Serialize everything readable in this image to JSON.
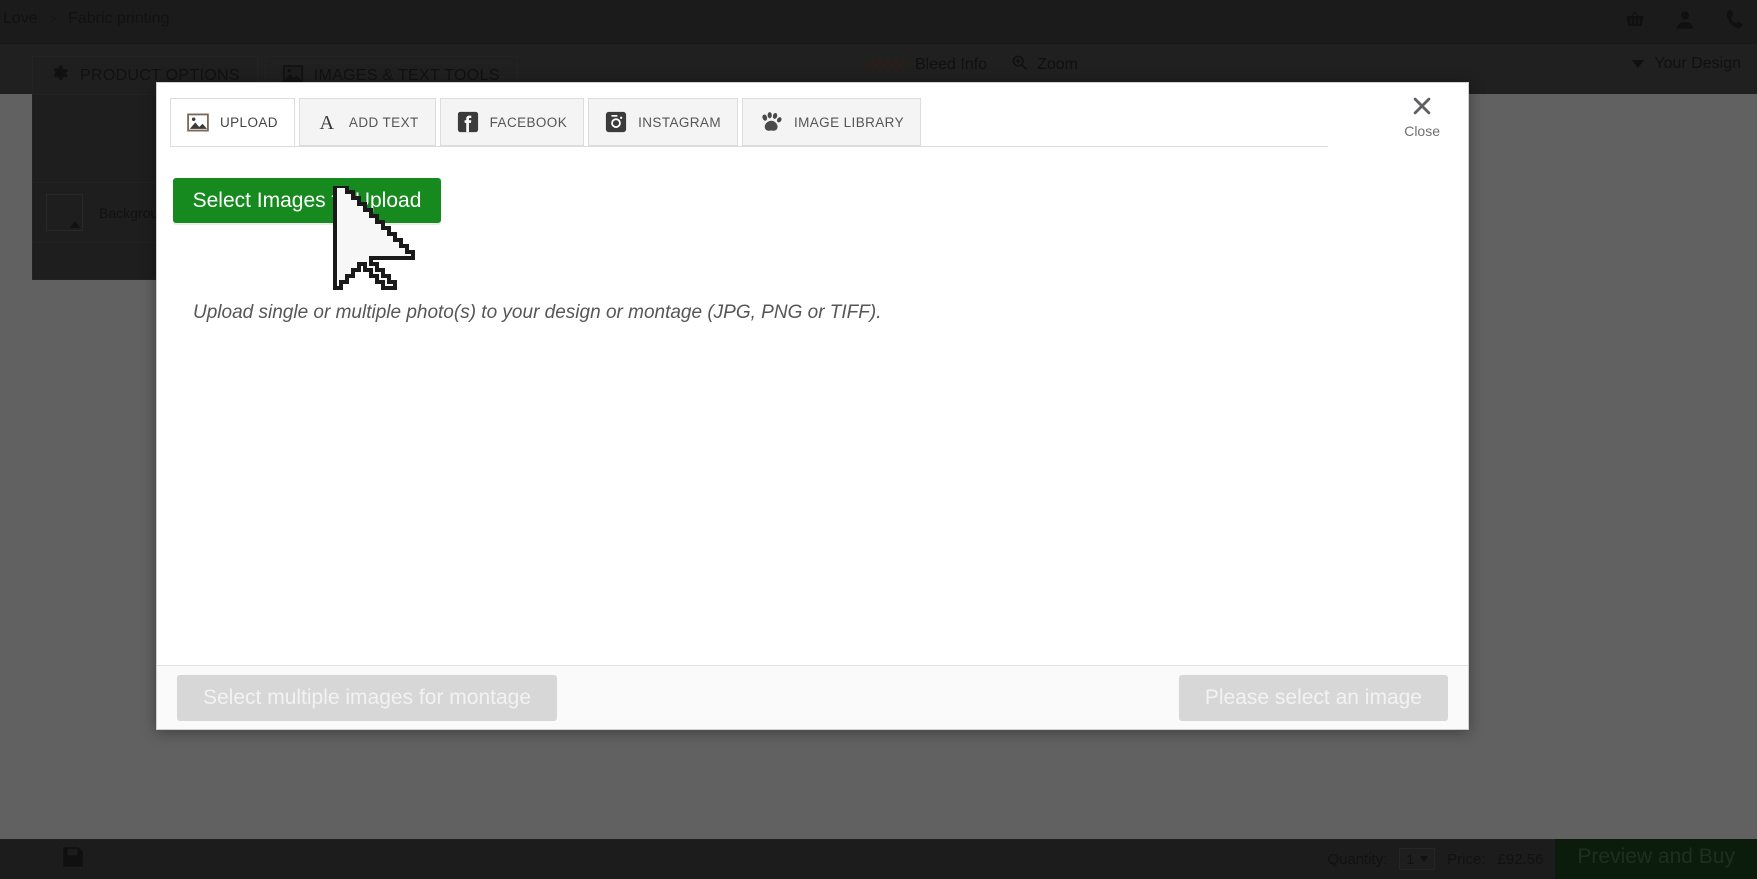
{
  "background": {
    "breadcrumb": {
      "parent": "f Love",
      "separator": ">",
      "current": "Fabric printing"
    },
    "top_icons": [
      {
        "name": "basket-icon",
        "label": "Basket"
      },
      {
        "name": "user-icon",
        "label": "Account"
      },
      {
        "name": "phone-icon",
        "label": "Contact"
      }
    ],
    "toolbar_center": {
      "bleed_label": "Bleed Info",
      "zoom_label": "Zoom"
    },
    "your_design_label": "Your Design",
    "tabs": [
      {
        "label": "PRODUCT OPTIONS",
        "icon": "gear-icon",
        "active": false
      },
      {
        "label": "IMAGES & TEXT TOOLS",
        "icon": "image-icon",
        "active": true
      }
    ],
    "panel": {
      "background_color_label": "Background Co"
    },
    "bottom_bar": {
      "save_icon": "save-icon",
      "quantity_label": "Quantity:",
      "quantity_value": "1",
      "price_label": "Price:",
      "price_value": "£92.56",
      "preview_button": "Preview and Buy"
    }
  },
  "modal": {
    "tabs": [
      {
        "label": "UPLOAD",
        "icon": "image-upload-icon",
        "active": true
      },
      {
        "label": "ADD TEXT",
        "icon": "letter-a-icon",
        "active": false
      },
      {
        "label": "FACEBOOK",
        "icon": "facebook-icon",
        "active": false
      },
      {
        "label": "INSTAGRAM",
        "icon": "instagram-icon",
        "active": false
      },
      {
        "label": "IMAGE LIBRARY",
        "icon": "paw-print-icon",
        "active": false
      }
    ],
    "close": {
      "label": "Close",
      "icon": "close-x-icon"
    },
    "upload": {
      "button_label": "Select Images to Upload",
      "description": "Upload single or multiple photo(s) to your design or montage (JPG, PNG or TIFF)."
    },
    "footer": {
      "montage_button": "Select multiple images for montage",
      "select_button": "Please select an image"
    },
    "colors": {
      "upload_green": "#16891f",
      "disabled_button": "#d7d7d7"
    }
  }
}
